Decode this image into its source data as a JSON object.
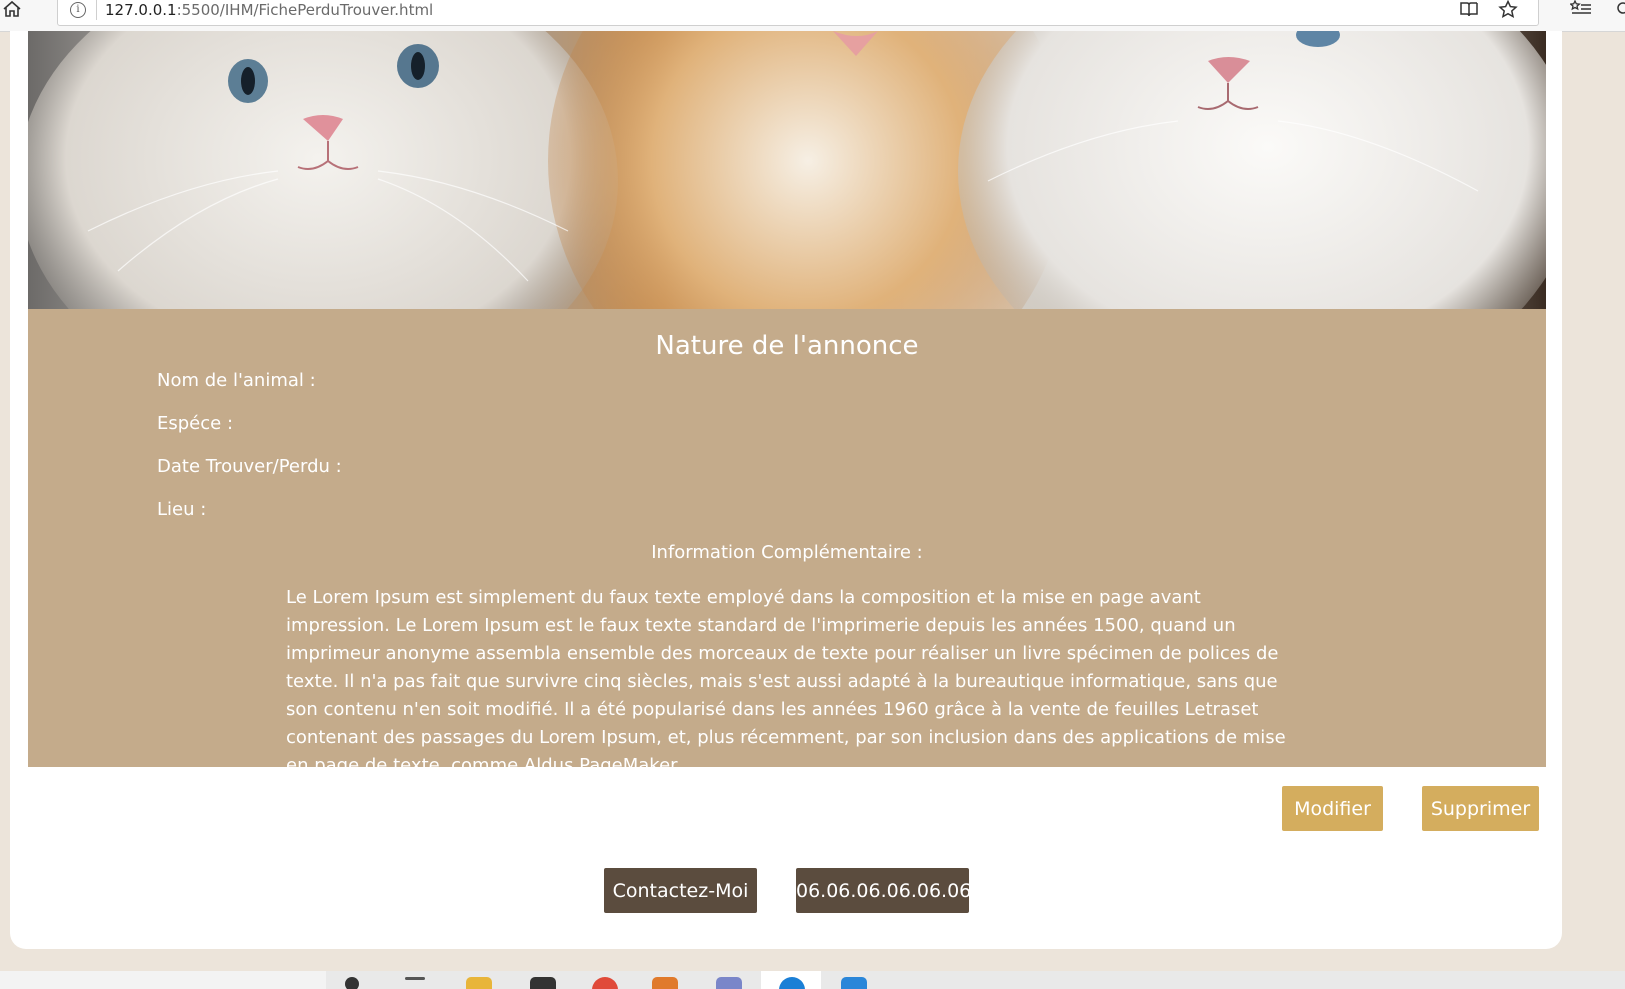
{
  "browser": {
    "url_host": "127.0.0.1",
    "url_path": ":5500/IHM/FichePerduTrouver.html",
    "icons": [
      "home-icon",
      "site-info-icon",
      "reader-view-icon",
      "favorite-star-icon",
      "favorites-list-icon",
      "profile-icon"
    ]
  },
  "hero": {
    "image": "three-kittens-photo"
  },
  "annonce": {
    "title": "Nature de l'annonce",
    "fields": {
      "nom": "Nom de l'animal :",
      "espece": "Espéce :",
      "date": "Date Trouver/Perdu :",
      "lieu": "Lieu :"
    },
    "info_label": "Information Complémentaire :",
    "info_text": "Le Lorem Ipsum est simplement du faux texte employé dans la composition et la mise en page avant impression. Le Lorem Ipsum est le faux texte standard de l'imprimerie depuis les années 1500, quand un imprimeur anonyme assembla ensemble des morceaux de texte pour réaliser un livre spécimen de polices de texte. Il n'a pas fait que survivre cinq siècles, mais s'est aussi adapté à la bureautique informatique, sans que son contenu n'en soit modifié. Il a été popularisé dans les années 1960 grâce à la vente de feuilles Letraset contenant des passages du Lorem Ipsum, et, plus récemment, par son inclusion dans des applications de mise en page de texte, comme Aldus PageMaker."
  },
  "actions": {
    "modify": "Modifier",
    "delete": "Supprimer",
    "contact": "Contactez-Moi",
    "phone": "06.06.06.06.06.06"
  },
  "colors": {
    "content_bg": "#c4ab8b",
    "gold_button": "#d4ad5e",
    "dark_button": "#5b4c3e",
    "page_bg": "#ece4da"
  }
}
